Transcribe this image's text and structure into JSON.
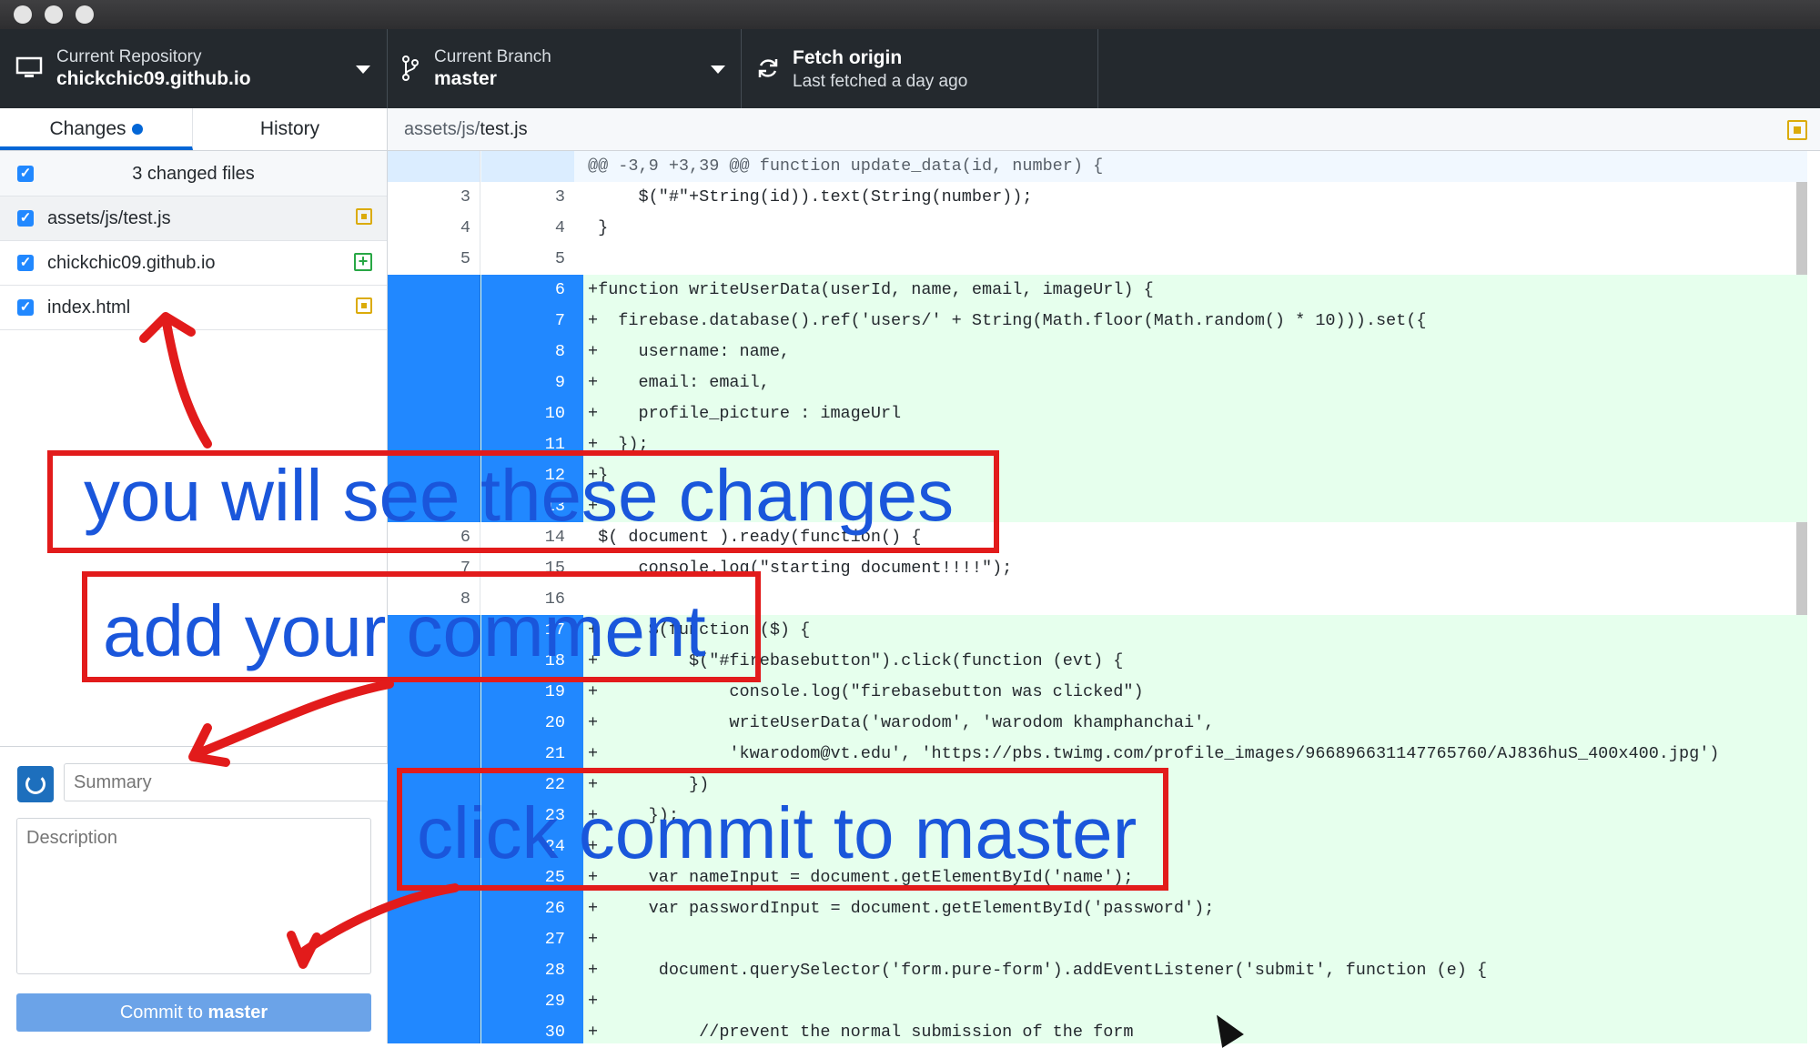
{
  "toolbar": {
    "repo_label": "Current Repository",
    "repo_name": "chickchic09.github.io",
    "branch_label": "Current Branch",
    "branch_name": "master",
    "fetch_title": "Fetch origin",
    "fetch_sub": "Last fetched a day ago"
  },
  "tabs": {
    "changes": "Changes",
    "history": "History"
  },
  "files": {
    "summary": "3 changed files",
    "items": [
      {
        "name": "assets/js/test.js",
        "status": "modified"
      },
      {
        "name": "chickchic09.github.io",
        "status": "added"
      },
      {
        "name": "index.html",
        "status": "modified"
      }
    ]
  },
  "commit": {
    "summary_placeholder": "Summary",
    "description_placeholder": "Description",
    "button_prefix": "Commit to ",
    "button_branch": "master"
  },
  "diff": {
    "path_dir": "assets/js/",
    "path_file": "test.js",
    "lines": [
      {
        "type": "hunk",
        "old": "",
        "new": "",
        "text": "@@ -3,9 +3,39 @@ function update_data(id, number) {"
      },
      {
        "type": "ctx",
        "old": "3",
        "new": "3",
        "text": "     $(\"#\"+String(id)).text(String(number));"
      },
      {
        "type": "ctx",
        "old": "4",
        "new": "4",
        "text": " }"
      },
      {
        "type": "ctx",
        "old": "5",
        "new": "5",
        "text": ""
      },
      {
        "type": "add",
        "old": "",
        "new": "6",
        "text": "+function writeUserData(userId, name, email, imageUrl) {"
      },
      {
        "type": "add",
        "old": "",
        "new": "7",
        "text": "+  firebase.database().ref('users/' + String(Math.floor(Math.random() * 10))).set({"
      },
      {
        "type": "add",
        "old": "",
        "new": "8",
        "text": "+    username: name,"
      },
      {
        "type": "add",
        "old": "",
        "new": "9",
        "text": "+    email: email,"
      },
      {
        "type": "add",
        "old": "",
        "new": "10",
        "text": "+    profile_picture : imageUrl"
      },
      {
        "type": "add",
        "old": "",
        "new": "11",
        "text": "+  });"
      },
      {
        "type": "add",
        "old": "",
        "new": "12",
        "text": "+}"
      },
      {
        "type": "add",
        "old": "",
        "new": "13",
        "text": "+"
      },
      {
        "type": "ctx",
        "old": "6",
        "new": "14",
        "text": " $( document ).ready(function() {"
      },
      {
        "type": "ctx",
        "old": "7",
        "new": "15",
        "text": "     console.log(\"starting document!!!!\");"
      },
      {
        "type": "ctx",
        "old": "8",
        "new": "16",
        "text": ""
      },
      {
        "type": "add",
        "old": "",
        "new": "17",
        "text": "+     $(function ($) {"
      },
      {
        "type": "add",
        "old": "",
        "new": "18",
        "text": "+         $(\"#firebasebutton\").click(function (evt) {"
      },
      {
        "type": "add",
        "old": "",
        "new": "19",
        "text": "+             console.log(\"firebasebutton was clicked\")"
      },
      {
        "type": "add",
        "old": "",
        "new": "20",
        "text": "+             writeUserData('warodom', 'warodom khamphanchai',"
      },
      {
        "type": "add",
        "old": "",
        "new": "21",
        "text": "+             'kwarodom@vt.edu', 'https://pbs.twimg.com/profile_images/966896631147765760/AJ836huS_400x400.jpg')"
      },
      {
        "type": "add",
        "old": "",
        "new": "22",
        "text": "+         })"
      },
      {
        "type": "add",
        "old": "",
        "new": "23",
        "text": "+     });"
      },
      {
        "type": "add",
        "old": "",
        "new": "24",
        "text": "+"
      },
      {
        "type": "add",
        "old": "",
        "new": "25",
        "text": "+     var nameInput = document.getElementById('name');"
      },
      {
        "type": "add",
        "old": "",
        "new": "26",
        "text": "+     var passwordInput = document.getElementById('password');"
      },
      {
        "type": "add",
        "old": "",
        "new": "27",
        "text": "+"
      },
      {
        "type": "add",
        "old": "",
        "new": "28",
        "text": "+      document.querySelector('form.pure-form').addEventListener('submit', function (e) {"
      },
      {
        "type": "add",
        "old": "",
        "new": "29",
        "text": "+"
      },
      {
        "type": "add",
        "old": "",
        "new": "30",
        "text": "+          //prevent the normal submission of the form"
      }
    ]
  },
  "annotations": {
    "changes_note": "you will see these changes",
    "comment_note": "add your comment",
    "commit_note": "click commit to master"
  },
  "colors": {
    "accent": "#0366d6",
    "annotation_red": "#e21b1b",
    "annotation_blue": "#1a56db",
    "added_bg": "#e6ffed"
  }
}
